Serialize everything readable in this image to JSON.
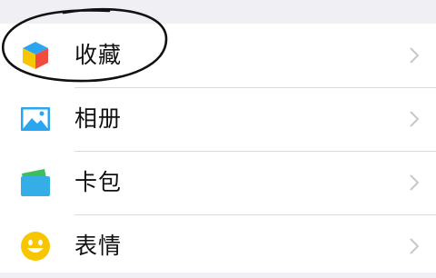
{
  "menu": {
    "items": [
      {
        "label": "收藏",
        "icon": "cube-icon"
      },
      {
        "label": "相册",
        "icon": "photo-icon"
      },
      {
        "label": "卡包",
        "icon": "wallet-icon"
      },
      {
        "label": "表情",
        "icon": "smiley-icon"
      }
    ]
  },
  "colors": {
    "background": "#efeff4",
    "list": "#ffffff",
    "chevron": "#c7c7cc",
    "accent_blue": "#2aa6f0",
    "accent_yellow": "#f8c600",
    "annotation_ink": "#000000"
  }
}
